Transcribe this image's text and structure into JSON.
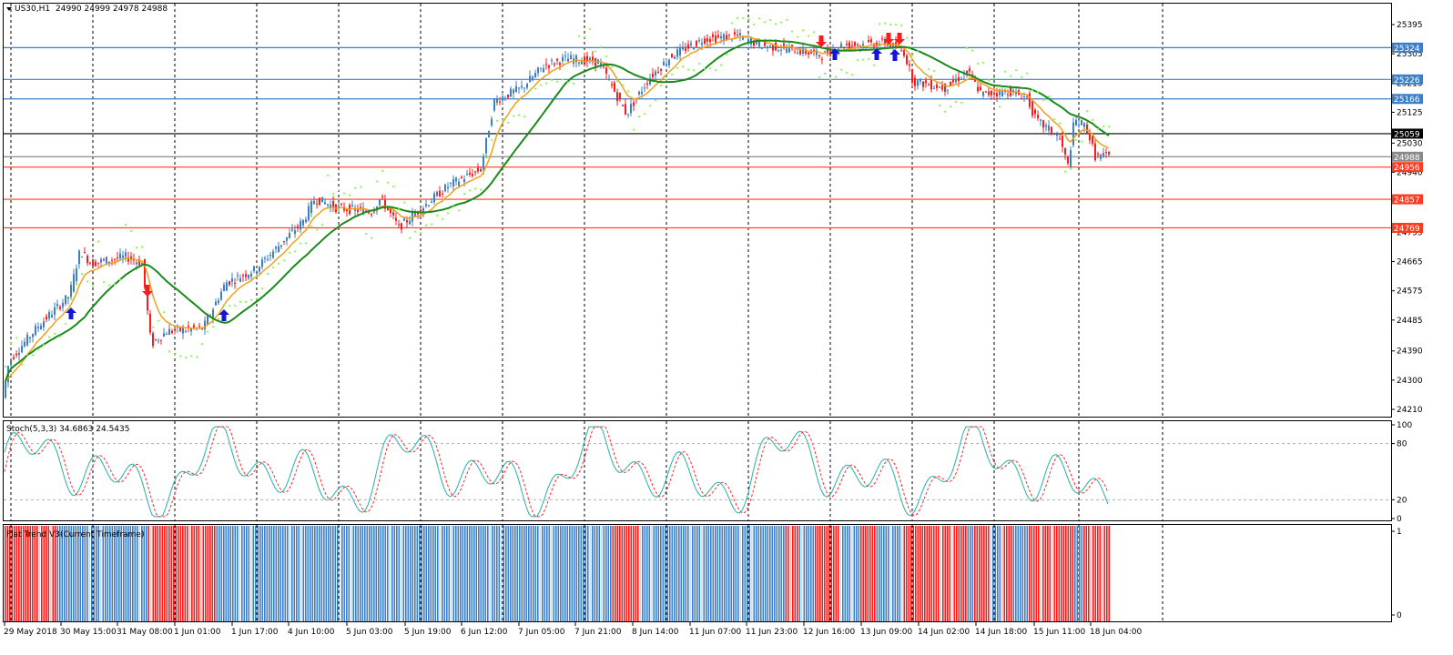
{
  "main_panel": {
    "symbol_label": "US30,H1",
    "ohlc_values": "24990 24999 24978 24988",
    "price_axis_ticks": [
      "25395",
      "25305",
      "25215",
      "25125",
      "25030",
      "24940",
      "24850",
      "24755",
      "24665",
      "24575",
      "24485",
      "24390",
      "24300",
      "24210"
    ],
    "horizontal_levels": [
      {
        "value": "25324",
        "color": "#3d7fc6"
      },
      {
        "value": "25226",
        "color": "#3d7fc6"
      },
      {
        "value": "25166",
        "color": "#3d7fc6"
      },
      {
        "value": "25059",
        "color": "#000000"
      },
      {
        "value": "24988",
        "color": "#8a8a8a"
      },
      {
        "value": "24956",
        "color": "#ff3b1f"
      },
      {
        "value": "24857",
        "color": "#ff3b1f"
      },
      {
        "value": "24769",
        "color": "#ff3b1f"
      }
    ],
    "colors": {
      "bull": "#3d7fc6",
      "bear": "#ff1a1a",
      "ma_fast": "#f2a01c",
      "ma_slow": "#1a8a1a",
      "sar": "#7dff4f",
      "arrow_up": "#1515d6",
      "arrow_down": "#ff1a1a"
    }
  },
  "stoch_panel": {
    "label": "Stoch(5,3,3) 34.6863 24.5435",
    "axis_ticks": [
      "100",
      "80",
      "20",
      "0"
    ],
    "colors": {
      "main": "#20b2aa",
      "signal": "#ff2a2a"
    }
  },
  "trend_panel": {
    "label": "Flat Trend V3(Current Timeframe)",
    "axis_ticks": [
      "1",
      "0"
    ],
    "colors": {
      "up": "#3d7fc6",
      "down": "#ff1a1a"
    }
  },
  "time_axis": {
    "labels": [
      "29 May 2018",
      "30 May 15:00",
      "31 May 08:00",
      "1 Jun 01:00",
      "1 Jun 17:00",
      "4 Jun 10:00",
      "5 Jun 03:00",
      "5 Jun 19:00",
      "6 Jun 12:00",
      "7 Jun 05:00",
      "7 Jun 21:00",
      "8 Jun 14:00",
      "11 Jun 07:00",
      "11 Jun 23:00",
      "12 Jun 16:00",
      "13 Jun 09:00",
      "14 Jun 02:00",
      "14 Jun 18:00",
      "15 Jun 11:00",
      "18 Jun 04:00"
    ]
  }
}
